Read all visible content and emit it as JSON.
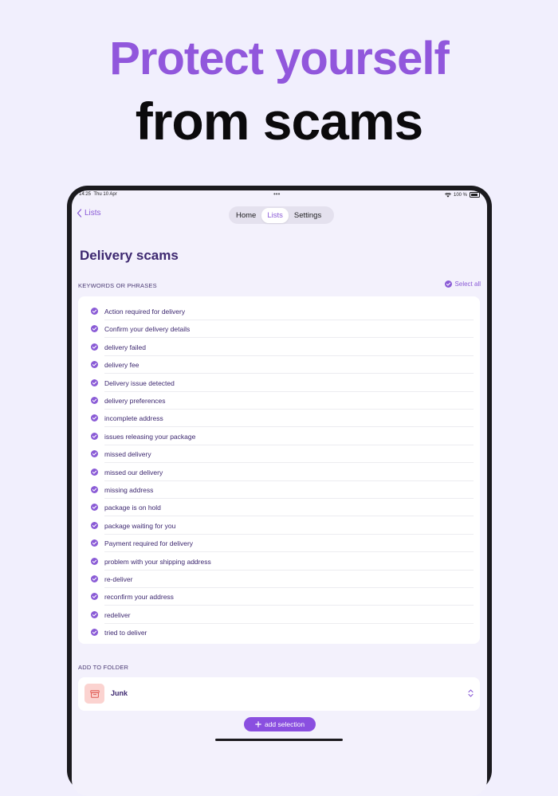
{
  "headline": {
    "line1": "Protect yourself",
    "line2": "from scams"
  },
  "status": {
    "time": "14:25",
    "date": "Thu 10 Apr",
    "battery": "100 %"
  },
  "nav": {
    "back_label": "Lists",
    "tabs": [
      "Home",
      "Lists",
      "Settings"
    ],
    "active_tab": "Lists"
  },
  "page": {
    "title": "Delivery scams"
  },
  "keywords_section": {
    "label": "KEYWORDS OR PHRASES",
    "select_all": "Select all",
    "items": [
      "Action required for delivery",
      "Confirm your delivery details",
      "delivery failed",
      "delivery fee",
      "Delivery issue detected",
      "delivery preferences",
      "incomplete address",
      "issues releasing your package",
      "missed delivery",
      "missed our delivery",
      "missing address",
      "package is on hold",
      "package waiting for you",
      "Payment required for delivery",
      "problem with your shipping address",
      "re-deliver",
      "reconfirm your address",
      "redeliver",
      "tried to deliver"
    ]
  },
  "folder_section": {
    "label": "ADD TO FOLDER",
    "folder_name": "Junk",
    "icon": "tray-icon"
  },
  "action": {
    "add_label": "add selection"
  },
  "colors": {
    "accent": "#8a5bd6",
    "headline_purple": "#9157dc",
    "junk_bg": "#fbd3d0"
  }
}
